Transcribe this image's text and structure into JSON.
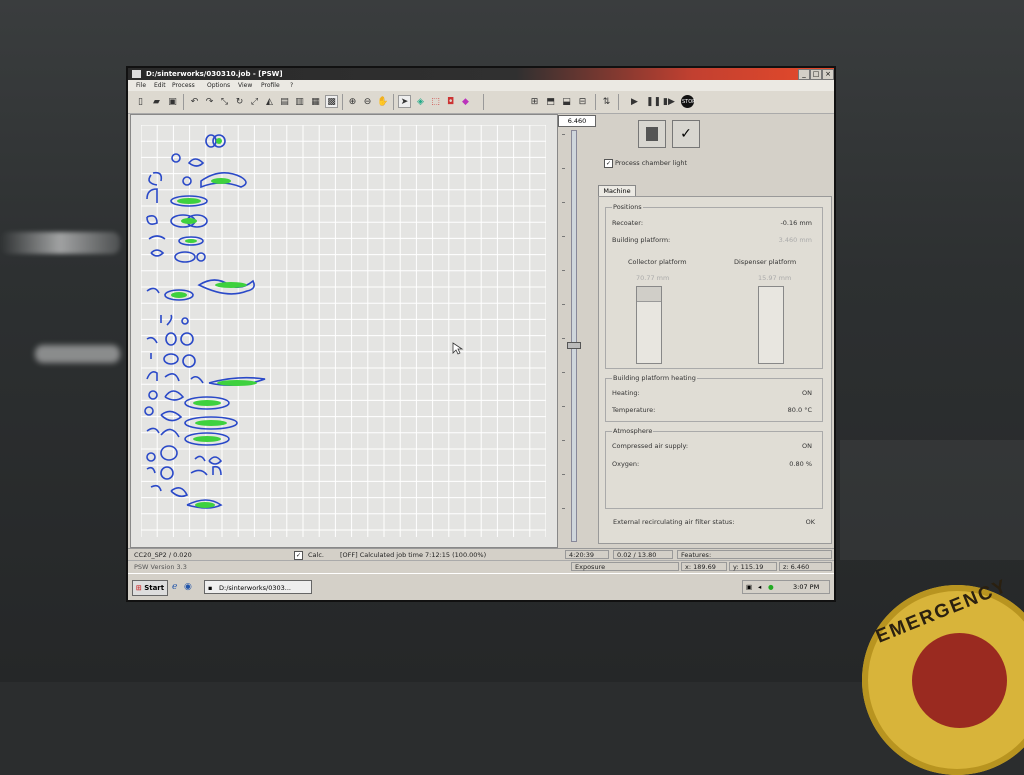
{
  "window": {
    "title": "D:/sinterworks/030310.job - [PSW]",
    "controls": [
      "_",
      "□",
      "×"
    ]
  },
  "menu": [
    "File",
    "Edit",
    "Process",
    "Options",
    "View",
    "Profile",
    "?"
  ],
  "layer": {
    "value": "6.460"
  },
  "right_panel": {
    "process_chamber_light_label": "Process chamber light",
    "process_chamber_light_checked": true,
    "tab": "Machine",
    "positions": {
      "title": "Positions",
      "recoater_label": "Recoater:",
      "recoater_value": "-0.16 mm",
      "building_platform_label": "Building platform:",
      "building_platform_value": "3.460 mm",
      "collector_label": "Collector platform",
      "collector_value": "70.77 mm",
      "dispenser_label": "Dispenser platform",
      "dispenser_value": "15.97 mm"
    },
    "heating": {
      "title": "Building platform heating",
      "heating_label": "Heating:",
      "heating_value": "ON",
      "temperature_label": "Temperature:",
      "temperature_value": "80.0 °C"
    },
    "atmosphere": {
      "title": "Atmosphere",
      "air_label": "Compressed air supply:",
      "air_value": "ON",
      "oxygen_label": "Oxygen:",
      "oxygen_value": "0.80 %"
    },
    "filter_label": "External recirculating air filter status:",
    "filter_value": "OK"
  },
  "status": {
    "profile": "CC20_SP2 / 0.020",
    "calc_label": "Calc.",
    "calc_checked": true,
    "calc_text": "[OFF]  Calculated job time 7:12:15  (100.00%)",
    "time": "4:20:39",
    "layer_info": "0.02 / 13.80",
    "features": "Features:",
    "version": "PSW Version 3.3",
    "exposure": "Exposure",
    "x": "x: 189.69",
    "y": "y: 115.19",
    "z": "z: 6.460"
  },
  "taskbar": {
    "start": "Start",
    "task": "D:/sinterworks/0303...",
    "clock": "3:07 PM"
  },
  "physical": {
    "emergency_label": "EMERGENCY"
  },
  "colors": {
    "part_outline": "#2a49c8",
    "part_fill": "#3ed13e",
    "grid_line": "#ffffff",
    "title_right": "#e84a2a"
  }
}
